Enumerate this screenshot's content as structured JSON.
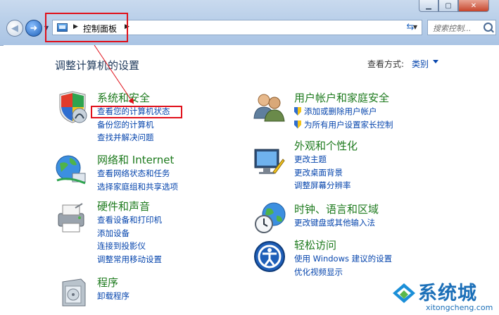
{
  "address": {
    "crumb": "控制面板",
    "search_placeholder": "搜索控制..."
  },
  "main": {
    "title": "调整计算机的设置",
    "view_by_label": "查看方式:",
    "view_by_value": "类别"
  },
  "categories": [
    {
      "title": "系统和安全",
      "links": [
        "查看您的计算机状态",
        "备份您的计算机",
        "查找并解决问题"
      ]
    },
    {
      "title": "网络和 Internet",
      "links": [
        "查看网络状态和任务",
        "选择家庭组和共享选项"
      ]
    },
    {
      "title": "硬件和声音",
      "links": [
        "查看设备和打印机",
        "添加设备",
        "连接到投影仪",
        "调整常用移动设置"
      ]
    },
    {
      "title": "程序",
      "links": [
        "卸载程序"
      ]
    },
    {
      "title": "用户帐户和家庭安全",
      "links": [
        "添加或删除用户帐户",
        "为所有用户设置家长控制"
      ]
    },
    {
      "title": "外观和个性化",
      "links": [
        "更改主题",
        "更改桌面背景",
        "调整屏幕分辨率"
      ]
    },
    {
      "title": "时钟、语言和区域",
      "links": [
        "更改键盘或其他输入法"
      ]
    },
    {
      "title": "轻松访问",
      "links": [
        "使用 Windows 建议的设置",
        "优化视频显示"
      ]
    }
  ],
  "watermark": {
    "text": "系统城",
    "sub": "xitongcheng.com"
  }
}
